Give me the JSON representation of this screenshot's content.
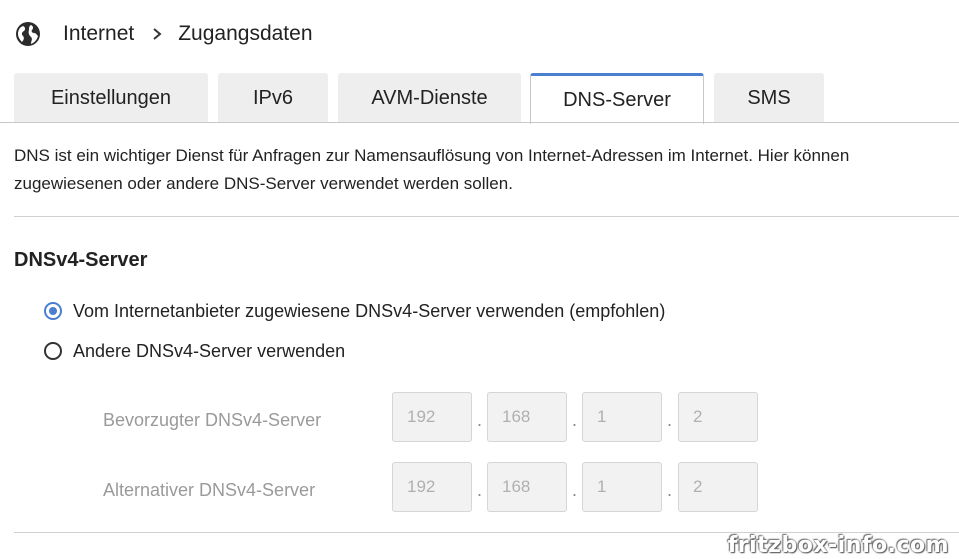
{
  "breadcrumb": {
    "icon": "globe-icon",
    "section": "Internet",
    "page": "Zugangsdaten"
  },
  "tabs": [
    {
      "label": "Einstellungen",
      "active": false
    },
    {
      "label": "IPv6",
      "active": false
    },
    {
      "label": "AVM-Dienste",
      "active": false
    },
    {
      "label": "DNS-Server",
      "active": true
    },
    {
      "label": "SMS",
      "active": false
    }
  ],
  "intro": {
    "line1": "DNS ist ein wichtiger Dienst für Anfragen zur Namensauflösung von Internet-Adressen im Internet. Hier können",
    "line2": "zugewiesenen oder andere DNS-Server verwendet werden sollen."
  },
  "dnsv4": {
    "title": "DNSv4-Server",
    "option_provider": "Vom Internetanbieter zugewiesene DNSv4-Server verwenden (empfohlen)",
    "option_other": "Andere DNSv4-Server verwenden",
    "selected": "provider",
    "preferred": {
      "label": "Bevorzugter DNSv4-Server",
      "octets": [
        "192",
        "168",
        "1",
        "2"
      ]
    },
    "alternative": {
      "label": "Alternativer DNSv4-Server",
      "octets": [
        "192",
        "168",
        "1",
        "2"
      ]
    }
  },
  "colors": {
    "accent": "#4a7fcf",
    "tab_inactive": "#eeeeee",
    "disabled_text": "#9a9a9a"
  },
  "watermark": "fritzbox-info.com"
}
